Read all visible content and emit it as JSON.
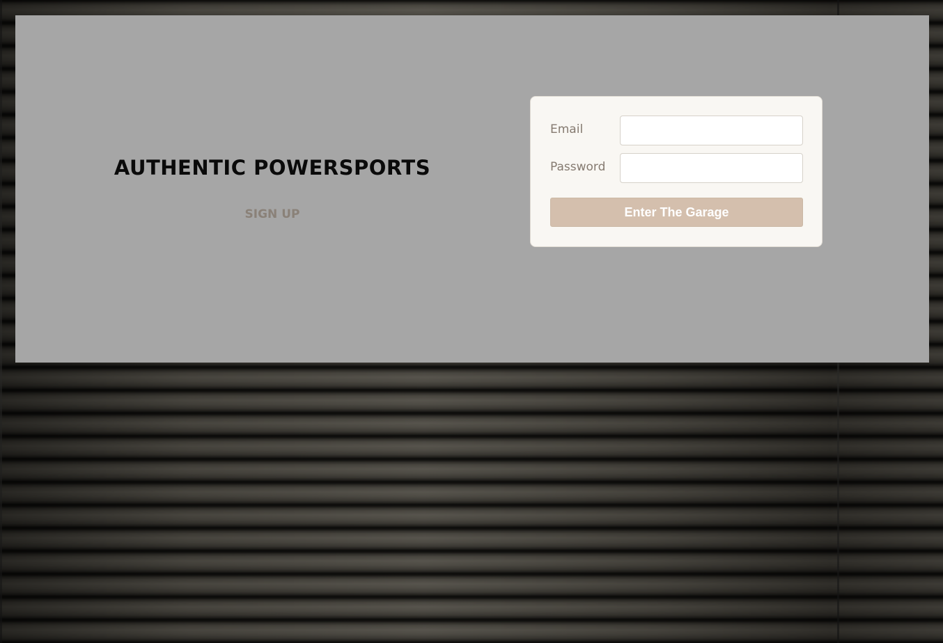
{
  "brand": {
    "title": "AUTHENTIC POWERSPORTS",
    "signup_label": "SIGN UP"
  },
  "login_form": {
    "email_label": "Email",
    "email_value": "",
    "password_label": "Password",
    "password_value": "",
    "submit_label": "Enter The Garage"
  },
  "colors": {
    "panel_background": "#a6a6a6",
    "card_background": "#f9f7f3",
    "button_background": "#d4bfad",
    "button_text": "#ffffff",
    "label_text": "#857a70",
    "signup_text": "#8a8178",
    "title_text": "#0a0a0a"
  },
  "background": {
    "image": "garage-shutter"
  }
}
